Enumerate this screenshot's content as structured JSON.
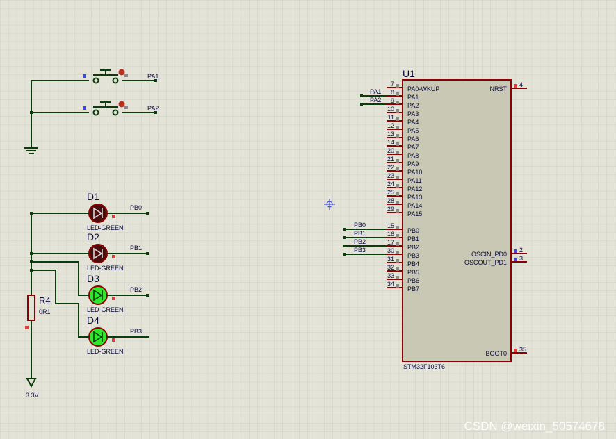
{
  "colors": {
    "background": "#e4e3d8",
    "grid": "#cfcfc4",
    "wire": "#0b3d0b",
    "component": "#8b0000",
    "chip_fill": "#c9c8b4",
    "pin_red": "#e23c3c",
    "pin_blue": "#3a48e6",
    "pin_gray": "#8a8a8a",
    "led_off": "#4a0d0d",
    "led_on": "#2ee82e"
  },
  "switches": [
    {
      "net": "PA1"
    },
    {
      "net": "PA2"
    }
  ],
  "leds": [
    {
      "ref": "D1",
      "type": "LED-GREEN",
      "net": "PB0",
      "state": "off"
    },
    {
      "ref": "D2",
      "type": "LED-GREEN",
      "net": "PB1",
      "state": "off"
    },
    {
      "ref": "D3",
      "type": "LED-GREEN",
      "net": "PB2",
      "state": "on"
    },
    {
      "ref": "D4",
      "type": "LED-GREEN",
      "net": "PB3",
      "state": "on"
    }
  ],
  "resistor": {
    "ref": "R4",
    "value": "0R1"
  },
  "power": {
    "label": "3.3V"
  },
  "chip": {
    "ref": "U1",
    "part": "STM32F103T6",
    "left_pins": [
      {
        "num": "7",
        "name": "PA0-WKUP",
        "net": ""
      },
      {
        "num": "8",
        "name": "PA1",
        "net": "PA1"
      },
      {
        "num": "9",
        "name": "PA2",
        "net": "PA2"
      },
      {
        "num": "10",
        "name": "PA3",
        "net": ""
      },
      {
        "num": "11",
        "name": "PA4",
        "net": ""
      },
      {
        "num": "12",
        "name": "PA5",
        "net": ""
      },
      {
        "num": "13",
        "name": "PA6",
        "net": ""
      },
      {
        "num": "14",
        "name": "PA7",
        "net": ""
      },
      {
        "num": "20",
        "name": "PA8",
        "net": ""
      },
      {
        "num": "21",
        "name": "PA9",
        "net": ""
      },
      {
        "num": "22",
        "name": "PA10",
        "net": ""
      },
      {
        "num": "23",
        "name": "PA11",
        "net": ""
      },
      {
        "num": "24",
        "name": "PA12",
        "net": ""
      },
      {
        "num": "25",
        "name": "PA13",
        "net": ""
      },
      {
        "num": "28",
        "name": "PA14",
        "net": ""
      },
      {
        "num": "29",
        "name": "PA15",
        "net": ""
      },
      {
        "num": "15",
        "name": "PB0",
        "net": "PB0"
      },
      {
        "num": "16",
        "name": "PB1",
        "net": "PB1"
      },
      {
        "num": "17",
        "name": "PB2",
        "net": "PB2"
      },
      {
        "num": "30",
        "name": "PB3",
        "net": "PB3"
      },
      {
        "num": "31",
        "name": "PB4",
        "net": ""
      },
      {
        "num": "32",
        "name": "PB5",
        "net": ""
      },
      {
        "num": "33",
        "name": "PB6",
        "net": ""
      },
      {
        "num": "34",
        "name": "PB7",
        "net": ""
      }
    ],
    "right_pins": [
      {
        "num": "4",
        "name": "NRST"
      },
      {
        "num": "2",
        "name": "OSCIN_PD0"
      },
      {
        "num": "3",
        "name": "OSCOUT_PD1"
      },
      {
        "num": "35",
        "name": "BOOT0"
      }
    ]
  },
  "watermark": "CSDN @weixin_50574678"
}
